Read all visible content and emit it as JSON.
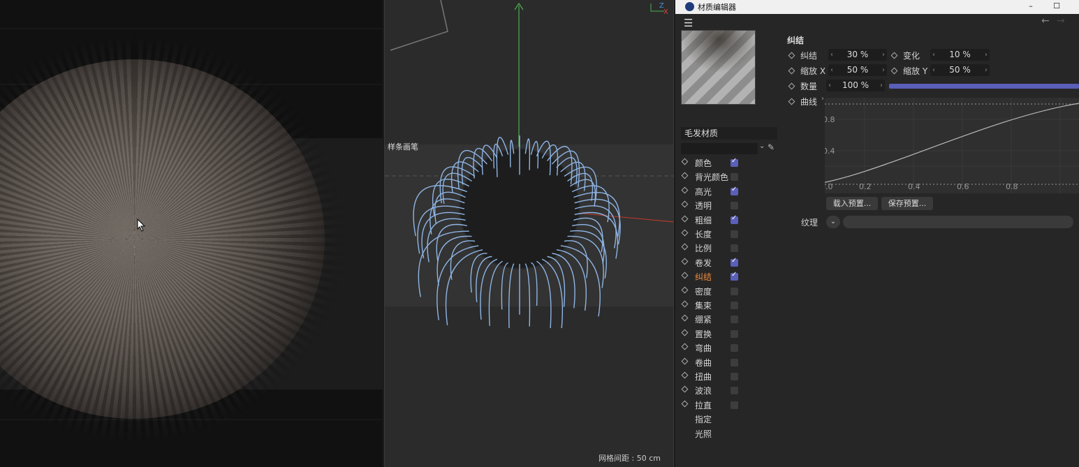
{
  "window": {
    "title": "材质编辑器",
    "min": "–",
    "max": "☐"
  },
  "viewport": {
    "label": "样条画笔",
    "grid_spacing": "网格间距 : 50 cm",
    "axis_z": "Z",
    "axis_x": "X"
  },
  "material": {
    "name": "毛发材质",
    "channels": [
      {
        "label": "颜色",
        "checked": true
      },
      {
        "label": "背光颜色",
        "checked": false
      },
      {
        "label": "高光",
        "checked": true
      },
      {
        "label": "透明",
        "checked": false
      },
      {
        "label": "粗细",
        "checked": true
      },
      {
        "label": "长度",
        "checked": false
      },
      {
        "label": "比例",
        "checked": false
      },
      {
        "label": "卷发",
        "checked": true
      },
      {
        "label": "纠结",
        "checked": true,
        "active": true
      },
      {
        "label": "密度",
        "checked": false
      },
      {
        "label": "集束",
        "checked": false
      },
      {
        "label": "绷紧",
        "checked": false
      },
      {
        "label": "置换",
        "checked": false
      },
      {
        "label": "弯曲",
        "checked": false
      },
      {
        "label": "卷曲",
        "checked": false
      },
      {
        "label": "扭曲",
        "checked": false
      },
      {
        "label": "波浪",
        "checked": false
      },
      {
        "label": "拉直",
        "checked": false
      },
      {
        "label": "指定",
        "no_box": true
      },
      {
        "label": "光照",
        "no_box": true
      }
    ]
  },
  "kink": {
    "section_title": "纠结",
    "kink_label": "纠结",
    "kink_value": "30 %",
    "variation_label": "变化",
    "variation_value": "10 %",
    "scale_x_label": "缩放 X",
    "scale_x_value": "50 %",
    "scale_y_label": "缩放 Y",
    "scale_y_value": "50 %",
    "amount_label": "数量",
    "amount_value": "100 %",
    "amount_fraction": 1.0,
    "curve_label": "曲线",
    "curve_y_ticks": [
      "0.8",
      "0.4"
    ],
    "curve_x_ticks": [
      "0.0",
      "0.2",
      "0.4",
      "0.6",
      "0.8"
    ],
    "load_preset": "载入预置...",
    "save_preset": "保存预置...",
    "texture_label": "纹理"
  },
  "colors": {
    "accent": "#5a5fb8",
    "active_channel": "#f08a3c",
    "hair_guides": "#8fb6e6"
  }
}
